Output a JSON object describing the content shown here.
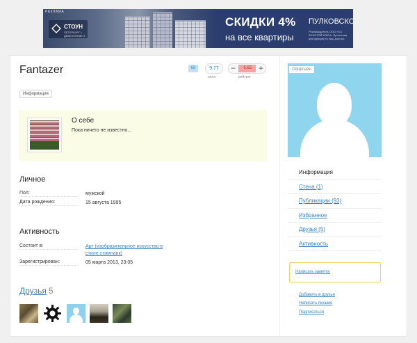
{
  "ad": {
    "tag": "РЕКЛАМА",
    "logo_name": "СТОУН",
    "logo_sub": "ПЕТЕРБУРГ • ДЕВЕЛОПМЕНТ",
    "title": "СКИДКИ 4%",
    "subtitle": "на все квартиры",
    "address": "ПУЛКОВСКОЕ, 34",
    "fine_print": "Рекламодатель ООО «СЗ ЗОЛОТОЙ КЛЮЧ» Проектная декларация на наш.дом.рф"
  },
  "profile": {
    "username": "Fantazer",
    "badge": "68",
    "karma": "9.77",
    "karma_label": "сила",
    "rating_minus": "−",
    "rating": "-5.65",
    "rating_plus": "+",
    "rating_label": "рейтинг",
    "info_tag": "Информация"
  },
  "about": {
    "title": "О себе",
    "text": "Пока ничего не известно..."
  },
  "personal": {
    "title": "Личное",
    "rows": [
      {
        "label": "Пол:",
        "value": "мужской"
      },
      {
        "label": "Дата рождения:",
        "value": "15 августа 1995"
      }
    ]
  },
  "activity": {
    "title": "Активность",
    "member_label": "Состоит в:",
    "member_value": "Арт (изобразительное искусство в стиле стимпанк)",
    "registered_label": "Зарегистрирован:",
    "registered_value": "05 марта 2013, 23:05"
  },
  "friends": {
    "title": "Друзья",
    "count": "5"
  },
  "sidebar": {
    "status": "Оффлайн",
    "menu": [
      {
        "label": "Информация",
        "active": true
      },
      {
        "label": "Стена (1)"
      },
      {
        "label": "Публикации (93)"
      },
      {
        "label": "Избранное"
      },
      {
        "label": "Друзья (5)"
      },
      {
        "label": "Активность"
      }
    ],
    "write_note": "Написать заметку",
    "actions": [
      "Добавить в друзья",
      "Написать письмо",
      "Подписаться"
    ]
  },
  "colors": {
    "link": "#3b82c4",
    "about_bg": "#fbfce6",
    "avatar_bg": "#8fd5ee",
    "rating_bg": "#f5a3a3",
    "note_border": "#f3d25a"
  }
}
